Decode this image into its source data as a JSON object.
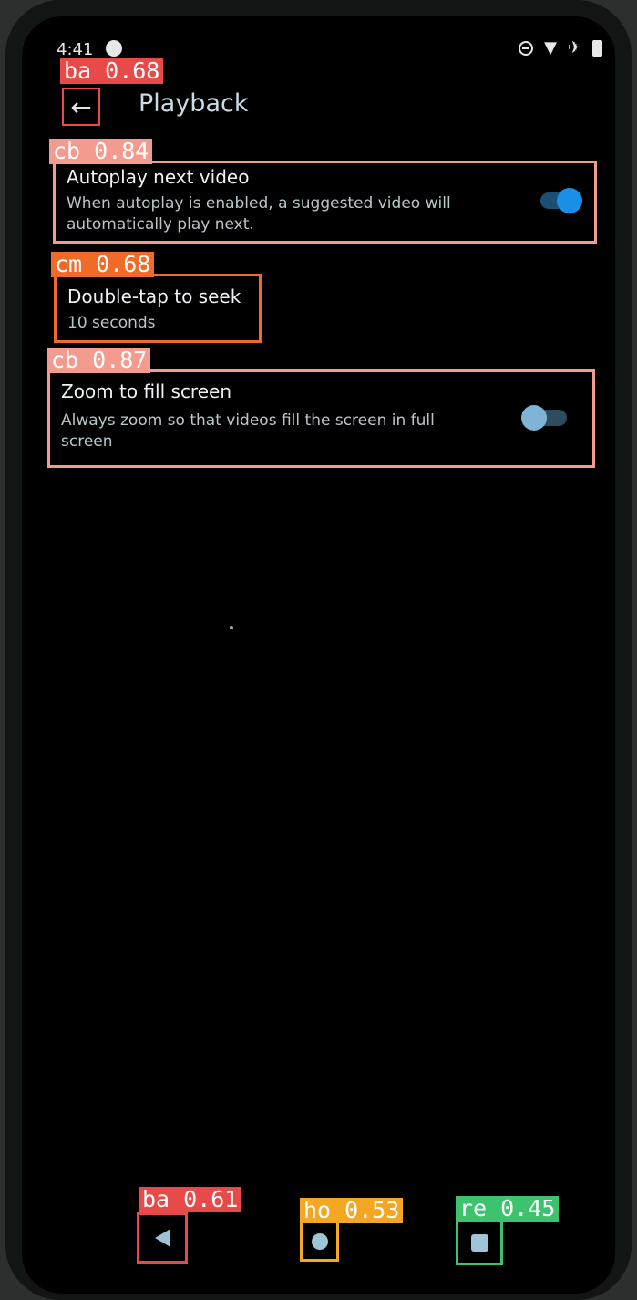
{
  "status_bar": {
    "time": "4:41"
  },
  "header": {
    "title": "Playback",
    "back_icon": "←"
  },
  "detections": {
    "back": "ba 0.68",
    "autoplay": "cb 0.84",
    "double_tap": "cm 0.68",
    "zoom": "cb 0.87",
    "nav_back": "ba 0.61",
    "nav_home": "ho 0.53",
    "nav_recents": "re 0.45"
  },
  "settings": {
    "autoplay": {
      "title": "Autoplay next video",
      "desc_line1": "When autoplay is enabled, a suggested video will",
      "desc_line2": "automatically play next.",
      "enabled": true
    },
    "double_tap": {
      "title": "Double-tap to seek",
      "value": "10 seconds"
    },
    "zoom": {
      "title": "Zoom to fill screen",
      "desc_line1": "Always zoom so that videos fill the screen in full",
      "desc_line2": "screen",
      "enabled": false
    }
  },
  "colors": {
    "badge_red": "#e84a4a",
    "badge_pink": "#f29b8e",
    "badge_orange": "#f06a2a",
    "badge_yellow": "#f5a623",
    "badge_green": "#3dc26e",
    "toggle_on": "#1a8fe8",
    "toggle_off": "#7fb4d6"
  }
}
